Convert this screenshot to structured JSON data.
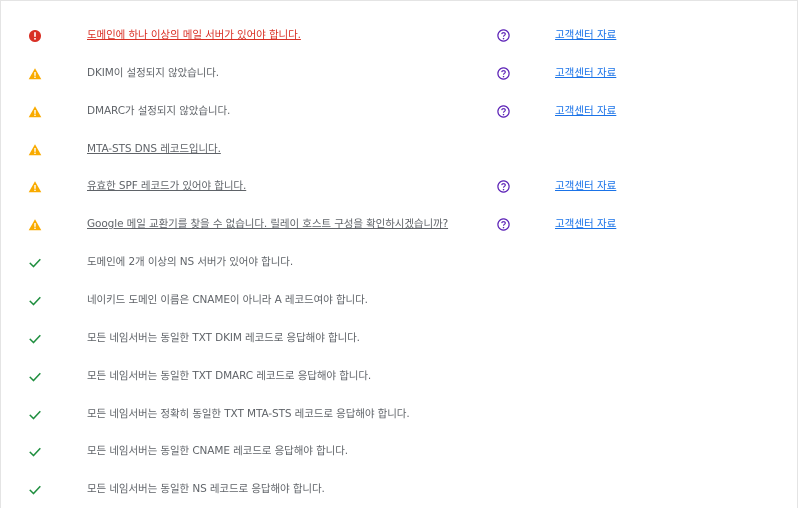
{
  "colors": {
    "error": "#d93025",
    "warning": "#f9ab00",
    "success": "#1e8e3e",
    "help": "#5b21b6",
    "link": "#1a73e8",
    "text": "#5f6368"
  },
  "checks": [
    {
      "status": "error",
      "icon": "error-icon",
      "message": "도메인에 하나 이상의 메일 서버가 있어야 합니다.",
      "message_link": true,
      "help_icon": "help-circle-icon",
      "support_label": "고객센터 자료"
    },
    {
      "status": "warning",
      "icon": "warning-icon",
      "message": "DKIM이 설정되지 않았습니다.",
      "message_link": false,
      "help_icon": "help-circle-icon",
      "support_label": "고객센터 자료"
    },
    {
      "status": "warning",
      "icon": "warning-icon",
      "message": "DMARC가 설정되지 않았습니다.",
      "message_link": false,
      "help_icon": "help-circle-icon",
      "support_label": "고객센터 자료"
    },
    {
      "status": "warning",
      "icon": "warning-icon",
      "message": "MTA-STS DNS 레코드입니다.",
      "message_link": true,
      "help_icon": null,
      "support_label": null
    },
    {
      "status": "warning",
      "icon": "warning-icon",
      "message": "유효한 SPF 레코드가 있어야 합니다.",
      "message_link": true,
      "help_icon": "help-circle-icon",
      "support_label": "고객센터 자료"
    },
    {
      "status": "warning",
      "icon": "warning-icon",
      "message": "Google 메일 교환기를 찾을 수 없습니다. 릴레이 호스트 구성을 확인하시겠습니까?",
      "message_link": true,
      "help_icon": "help-circle-icon",
      "support_label": "고객센터 자료"
    },
    {
      "status": "success",
      "icon": "checkmark-icon",
      "message": "도메인에 2개 이상의 NS 서버가 있어야 합니다.",
      "message_link": false,
      "help_icon": null,
      "support_label": null
    },
    {
      "status": "success",
      "icon": "checkmark-icon",
      "message": "네이키드 도메인 이름은 CNAME이 아니라 A 레코드여야 합니다.",
      "message_link": false,
      "help_icon": null,
      "support_label": null
    },
    {
      "status": "success",
      "icon": "checkmark-icon",
      "message": "모든 네임서버는 동일한 TXT DKIM 레코드로 응답해야 합니다.",
      "message_link": false,
      "help_icon": null,
      "support_label": null
    },
    {
      "status": "success",
      "icon": "checkmark-icon",
      "message": "모든 네임서버는 동일한 TXT DMARC 레코드로 응답해야 합니다.",
      "message_link": false,
      "help_icon": null,
      "support_label": null
    },
    {
      "status": "success",
      "icon": "checkmark-icon",
      "message": "모든 네임서버는 정확히 동일한 TXT MTA-STS 레코드로 응답해야 합니다.",
      "message_link": false,
      "help_icon": null,
      "support_label": null
    },
    {
      "status": "success",
      "icon": "checkmark-icon",
      "message": "모든 네임서버는 동일한 CNAME 레코드로 응답해야 합니다.",
      "message_link": false,
      "help_icon": null,
      "support_label": null
    },
    {
      "status": "success",
      "icon": "checkmark-icon",
      "message": "모든 네임서버는 동일한 NS 레코드로 응답해야 합니다.",
      "message_link": false,
      "help_icon": null,
      "support_label": null
    }
  ]
}
